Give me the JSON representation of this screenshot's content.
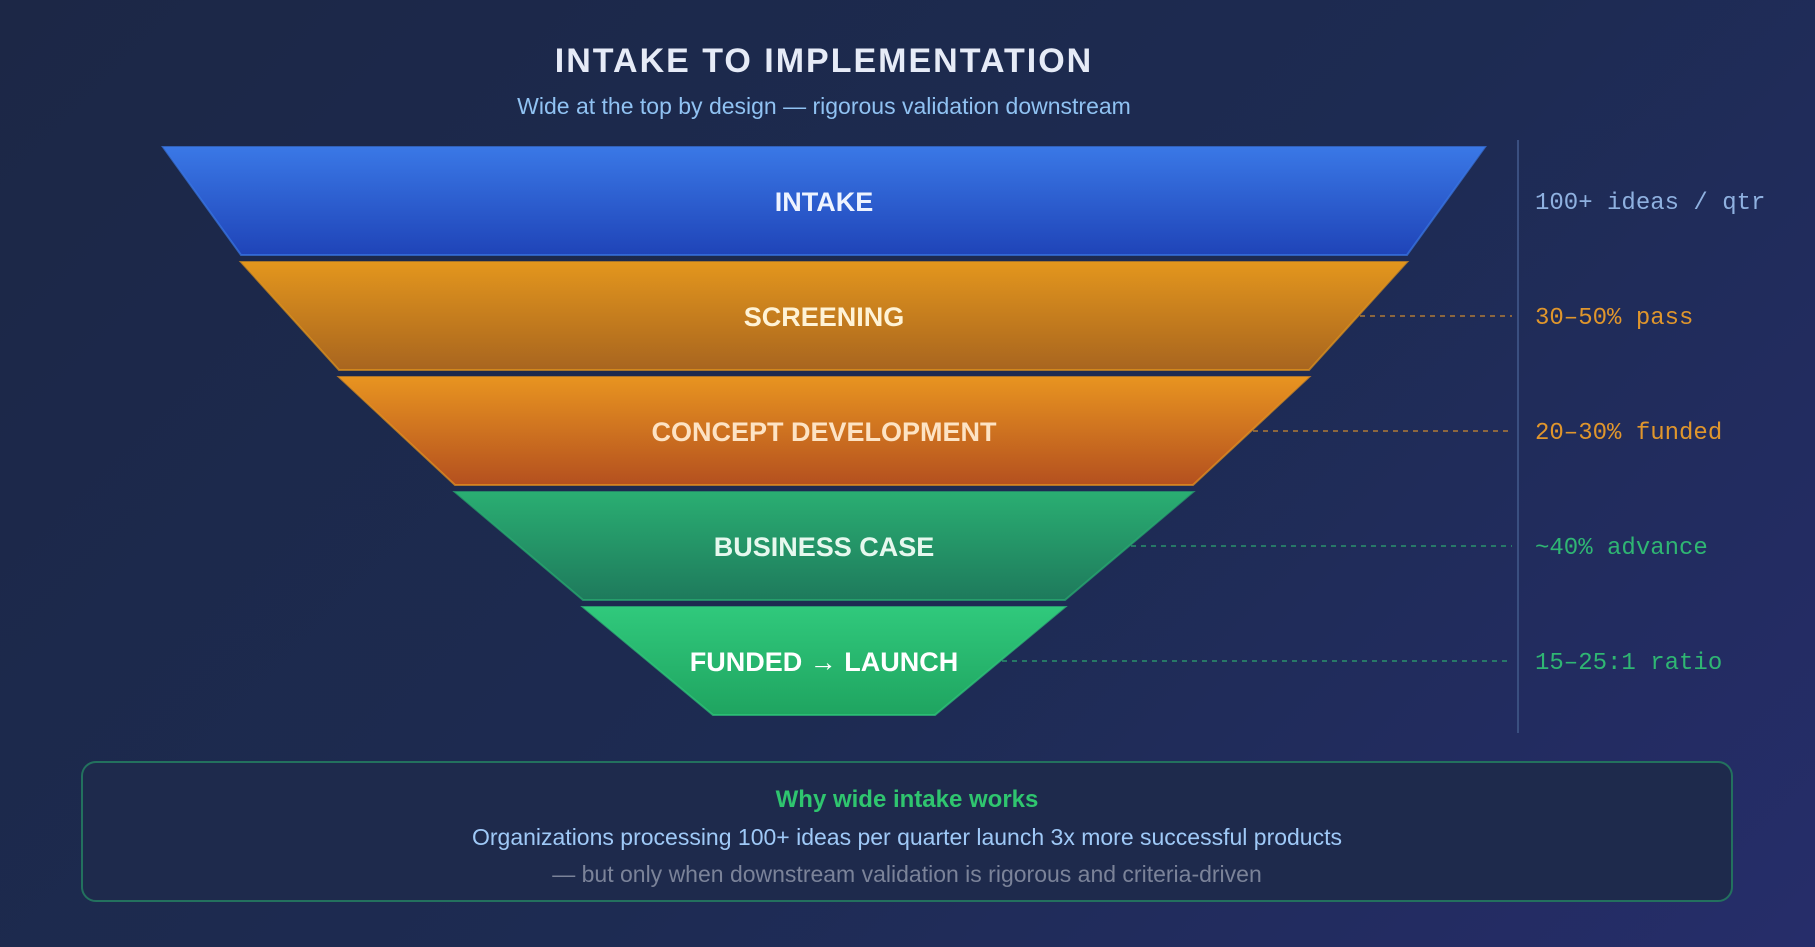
{
  "header": {
    "title": "INTAKE TO IMPLEMENTATION",
    "subtitle": "Wide at the top by design — rigorous validation downstream"
  },
  "funnel": {
    "stages": [
      {
        "label": "INTAKE",
        "metric": "100+ ideas / qtr",
        "color_top": "#3a78e6",
        "color_bottom": "#1f44b8",
        "label_color": "#eef3ff",
        "metric_color": "#8fb1e0"
      },
      {
        "label": "SCREENING",
        "metric": "30–50% pass",
        "color_top": "#e3961d",
        "color_bottom": "#a8651f",
        "label_color": "#fff3d6",
        "metric_color": "#e0962c"
      },
      {
        "label": "CONCEPT DEVELOPMENT",
        "metric": "20–30% funded",
        "color_top": "#e89420",
        "color_bottom": "#b4501f",
        "label_color": "#fde3c4",
        "metric_color": "#e0962c"
      },
      {
        "label": "BUSINESS CASE",
        "metric": "~40% advance",
        "color_top": "#2aae72",
        "color_bottom": "#1e7a5c",
        "label_color": "#e6f8ee",
        "metric_color": "#2fb673"
      },
      {
        "label": "FUNDED → LAUNCH",
        "metric": "15–25:1 ratio",
        "color_top": "#30c97c",
        "color_bottom": "#1fa460",
        "label_color": "#ffffff",
        "metric_color": "#2fb673"
      }
    ]
  },
  "note": {
    "heading": "Why wide intake works",
    "body": "Organizations processing 100+ ideas per quarter launch 3x more successful products",
    "footer": "— but only when downstream validation is rigorous and criteria-driven"
  }
}
